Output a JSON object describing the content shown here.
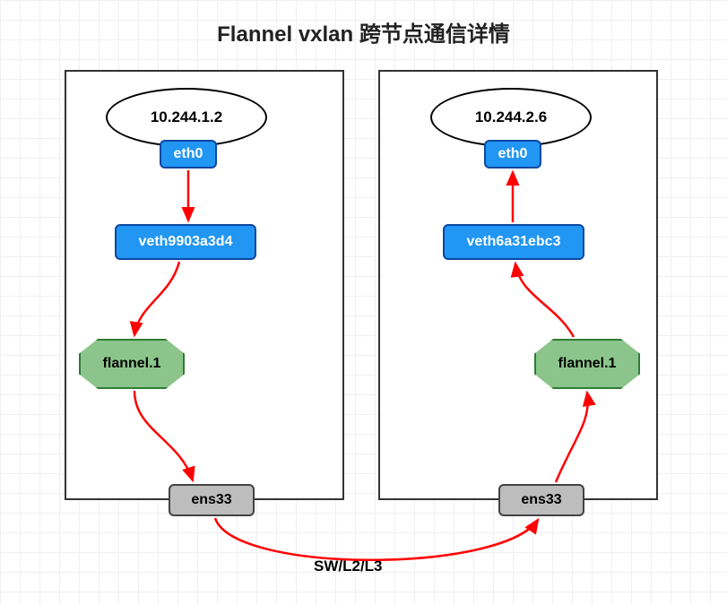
{
  "title": "Flannel vxlan 跨节点通信详情",
  "left": {
    "pod_ip": "10.244.1.2",
    "eth": "eth0",
    "veth": "veth9903a3d4",
    "flannel": "flannel.1",
    "ens": "ens33"
  },
  "right": {
    "pod_ip": "10.244.2.6",
    "eth": "eth0",
    "veth": "veth6a31ebc3",
    "flannel": "flannel.1",
    "ens": "ens33"
  },
  "bottom_label": "SW/L2/L3",
  "chart_data": {
    "type": "diagram",
    "title": "Flannel vxlan 跨节点通信详情",
    "description": "Network flow diagram showing cross-node communication via Flannel VXLAN between two Kubernetes nodes",
    "nodes": [
      {
        "id": "node1",
        "components": [
          {
            "type": "pod",
            "ip": "10.244.1.2",
            "interface": "eth0"
          },
          {
            "type": "veth",
            "name": "veth9903a3d4"
          },
          {
            "type": "flannel",
            "name": "flannel.1"
          },
          {
            "type": "host-interface",
            "name": "ens33"
          }
        ]
      },
      {
        "id": "node2",
        "components": [
          {
            "type": "pod",
            "ip": "10.244.2.6",
            "interface": "eth0"
          },
          {
            "type": "veth",
            "name": "veth6a31ebc3"
          },
          {
            "type": "flannel",
            "name": "flannel.1"
          },
          {
            "type": "host-interface",
            "name": "ens33"
          }
        ]
      }
    ],
    "flow": [
      {
        "from": "node1.pod.eth0",
        "to": "node1.veth",
        "direction": "down"
      },
      {
        "from": "node1.veth",
        "to": "node1.flannel",
        "direction": "down"
      },
      {
        "from": "node1.flannel",
        "to": "node1.ens33",
        "direction": "down"
      },
      {
        "from": "node1.ens33",
        "to": "node2.ens33",
        "via": "SW/L2/L3"
      },
      {
        "from": "node2.ens33",
        "to": "node2.flannel",
        "direction": "up"
      },
      {
        "from": "node2.flannel",
        "to": "node2.veth",
        "direction": "up"
      },
      {
        "from": "node2.veth",
        "to": "node2.pod.eth0",
        "direction": "up"
      }
    ]
  }
}
